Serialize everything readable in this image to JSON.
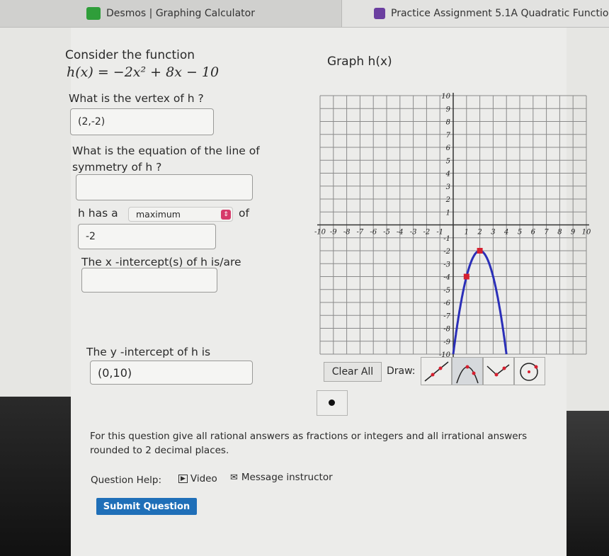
{
  "browser": {
    "tabs": [
      {
        "title": "Desmos | Graphing Calculator",
        "icon": "desmos-icon",
        "color": "#2f9e3a"
      },
      {
        "title": "Practice Assignment 5.1A Quadratic Functio",
        "icon": "assignment-icon",
        "color": "#6b3fa0"
      }
    ]
  },
  "question": {
    "intro": "Consider the function",
    "function": "h(x) = −2x² + 8x − 10",
    "graph_label": "Graph h(x)",
    "vertex_q": "What is the vertex of h ?",
    "vertex_answer": "(2,-2)",
    "symmetry_q1": "What is the equation of the line of",
    "symmetry_q2": "symmetry of h ?",
    "symmetry_answer": "",
    "has_a_prefix": "h  has a",
    "has_a_select": "maximum",
    "has_a_suffix": "of",
    "extreme_answer": "-2",
    "xint_q": "The x -intercept(s) of h  is/are",
    "xint_answer": "",
    "yint_q": "The y -intercept of h  is",
    "yint_answer": "(0,10)"
  },
  "graph_tools": {
    "clear_all": "Clear All",
    "draw_label": "Draw:",
    "tools": [
      "line-tool-icon",
      "parabola-tool-icon",
      "absolute-value-tool-icon",
      "circle-tool-icon"
    ],
    "selected_tool": "parabola-tool-icon"
  },
  "chart_data": {
    "type": "line",
    "xlim": [
      -10,
      10
    ],
    "ylim": [
      -10,
      10
    ],
    "grid": true,
    "x_ticks": [
      -10,
      -9,
      -8,
      -7,
      -6,
      -5,
      -4,
      -3,
      -2,
      -1,
      1,
      2,
      3,
      4,
      5,
      6,
      7,
      8,
      9,
      10
    ],
    "y_ticks": [
      -10,
      -9,
      -8,
      -7,
      -6,
      -5,
      -4,
      -3,
      -2,
      -1,
      1,
      2,
      3,
      4,
      5,
      6,
      7,
      8,
      9,
      10
    ],
    "curve": {
      "a": -2,
      "vertex": [
        2,
        -2
      ],
      "color": "#2b2fb8"
    },
    "points": [
      [
        2,
        -2
      ],
      [
        1,
        -4
      ]
    ],
    "point_color": "#d62030"
  },
  "footer": {
    "note": "For this question give all rational answers as fractions or integers and all irrational answers rounded to 2 decimal places.",
    "help_label": "Question Help:",
    "video": "Video",
    "message": "Message instructor",
    "submit": "Submit Question"
  }
}
